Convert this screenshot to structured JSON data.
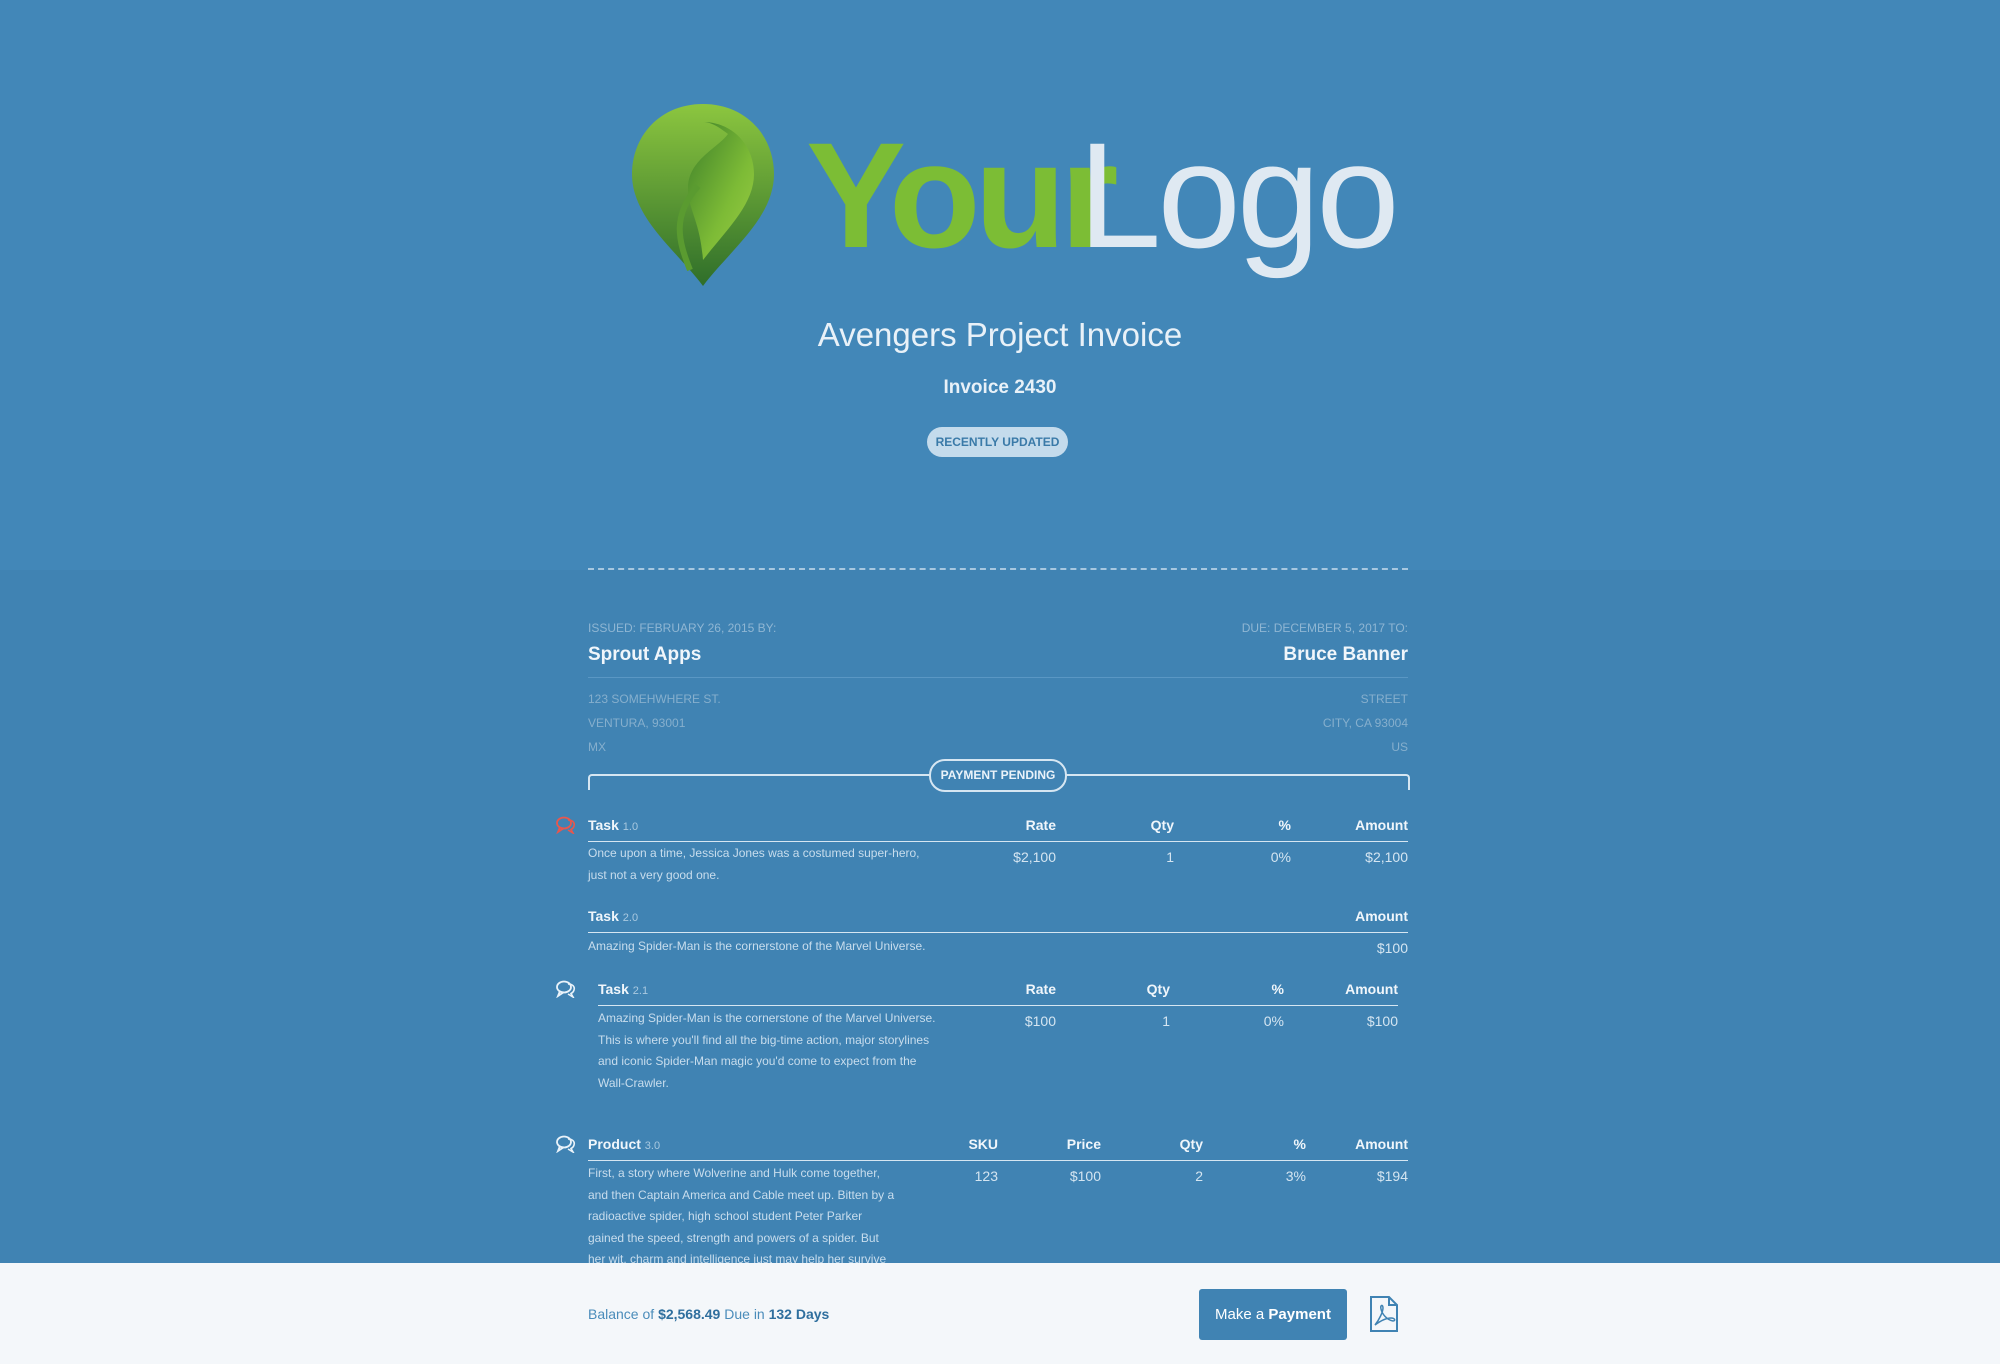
{
  "header": {
    "logo_your": "Your",
    "logo_logo": "Logo",
    "title": "Avengers Project Invoice",
    "invoice_number": "Invoice 2430",
    "badge": "RECENTLY UPDATED"
  },
  "issuer": {
    "label": "ISSUED: FEBRUARY 26, 2015 BY:",
    "name": "Sprout Apps",
    "address": [
      "123 SOMEHWHERE ST.",
      "VENTURA, 93001",
      "MX"
    ]
  },
  "recipient": {
    "label": "DUE: DECEMBER 5, 2017 TO:",
    "name": "Bruce Banner",
    "address": [
      "STREET",
      "CITY, CA 93004",
      "US"
    ]
  },
  "status_badge": "PAYMENT PENDING",
  "items": {
    "task1": {
      "title": "Task",
      "num": "1.0",
      "headers": {
        "rate": "Rate",
        "qty": "Qty",
        "pct": "%",
        "amount": "Amount"
      },
      "desc": [
        "Once upon a time, Jessica Jones was a costumed super-hero,",
        "just not a very good one."
      ],
      "rate": "$2,100",
      "qty": "1",
      "pct": "0%",
      "amount": "$2,100"
    },
    "task2": {
      "title": "Task",
      "num": "2.0",
      "headers": {
        "amount": "Amount"
      },
      "desc": "Amazing Spider-Man is the cornerstone of the Marvel Universe.",
      "amount": "$100"
    },
    "task21": {
      "title": "Task",
      "num": "2.1",
      "headers": {
        "rate": "Rate",
        "qty": "Qty",
        "pct": "%",
        "amount": "Amount"
      },
      "desc": [
        "Amazing Spider-Man is the cornerstone of the Marvel Universe.",
        "This is where you'll find all the big-time action, major storylines",
        "and iconic Spider-Man magic you'd come to expect from the",
        "Wall-Crawler."
      ],
      "rate": "$100",
      "qty": "1",
      "pct": "0%",
      "amount": "$100"
    },
    "product3": {
      "title": "Product",
      "num": "3.0",
      "headers": {
        "sku": "SKU",
        "price": "Price",
        "qty": "Qty",
        "pct": "%",
        "amount": "Amount"
      },
      "desc": [
        "First, a story where Wolverine and Hulk come together,",
        "and then Captain America and Cable meet up. Bitten by a",
        "radioactive spider, high school student Peter Parker",
        "gained the speed, strength and powers of a spider. But",
        "her wit, charm and intelligence just may help her survive"
      ],
      "sku": "123",
      "price": "$100",
      "qty": "2",
      "pct": "3%",
      "amount": "$194"
    }
  },
  "footer": {
    "balance_prefix": "Balance of",
    "balance": "$2,568.49",
    "due_prefix": "Due in",
    "due": "132 Days",
    "pay_prefix": "Make a",
    "pay_bold": "Payment"
  },
  "colors": {
    "accent": "#4083b3",
    "logo_green": "#7cbd35",
    "comment_icon_active": "#e8574d"
  }
}
